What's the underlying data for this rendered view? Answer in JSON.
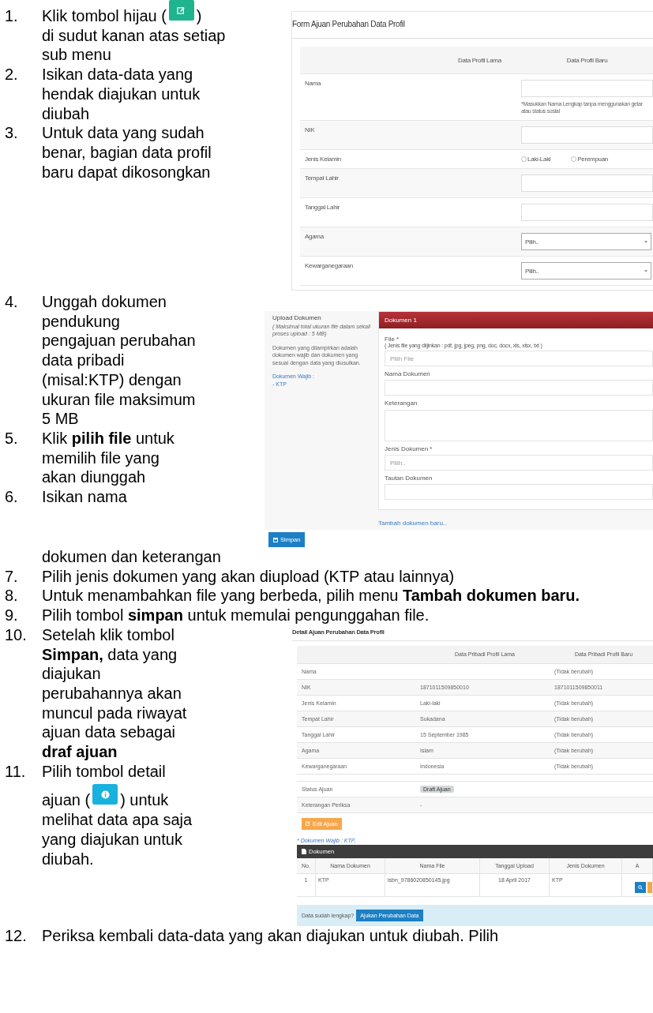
{
  "blocks": [
    {
      "kind": "with_screenshot",
      "steps": [
        {
          "kind": "edit_button",
          "number": "1.",
          "line_before": "Klik tombol hijau (",
          "line_after": ")",
          "text_after": "di sudut kanan atas setiap sub menu"
        },
        {
          "kind": "text",
          "number": "2.",
          "text": "Isikan data-data yang hendak diajukan untuk diubah"
        },
        {
          "kind": "text",
          "number": "3.",
          "text": "Untuk data yang sudah benar, bagian data profil baru dapat dikosongkan"
        }
      ],
      "screenshot": {
        "kind": "profile_form",
        "title": "Form Ajuan Perubahan Data Profil",
        "columns": [
          "Data Profil Lama",
          "Data Profil Baru"
        ],
        "rows": [
          {
            "label": "Nama",
            "kind": "text",
            "hint": "*Masukkan Nama Lengkap tanpa menggunakan gelar atau status sosial"
          },
          {
            "label": "NIK",
            "kind": "text"
          },
          {
            "label": "Jenis Kelamin",
            "kind": "radio",
            "options": [
              {
                "label": "Laki-Laki",
                "selected": false
              },
              {
                "label": "Perempuan",
                "selected": false
              }
            ]
          },
          {
            "label": "Tempat Lahir",
            "kind": "text"
          },
          {
            "label": "Tanggal Lahir",
            "kind": "text"
          },
          {
            "label": "Agama",
            "kind": "select",
            "placeholder": "Pilih.."
          },
          {
            "label": "Kewarganegaraan",
            "kind": "select",
            "placeholder": "Pilih.."
          }
        ]
      }
    },
    {
      "kind": "with_screenshot",
      "steps": [
        {
          "kind": "text",
          "number": "4.",
          "text": "Unggah dokumen pendukung pengajuan perubahan data pribadi (misal:KTP) dengan ukuran file maksimum 5 MB"
        },
        {
          "kind": "text",
          "number": "5.",
          "text": "Klik **pilih file** untuk memilih file yang akan diunggah"
        },
        {
          "kind": "text",
          "number": "6.",
          "text": "Isikan nama"
        }
      ],
      "screenshot": {
        "kind": "upload_form",
        "side_title": "Upload Dokumen",
        "side_note": "( Maksimal total ukuran file dalam sekali proses upload : 5 MB)",
        "side_text": "Dokumen yang dilampirkan adalah dokumen wajib dan dokumen yang sesuai dengan data yang diusulkan.",
        "required_label": "Dokumen Wajib :",
        "required_items": [
          "- KTP"
        ],
        "panel_title": "Dokumen 1",
        "fields": [
          {
            "label": "File *",
            "kind": "file",
            "hint": "( Jenis file yang diijinkan : pdf, jpg, jpeg, png, doc, docx, xls, xlsx, txt )",
            "placeholder": "Pilih File"
          },
          {
            "label": "Nama Dokumen",
            "kind": "text"
          },
          {
            "label": "Keterangan",
            "kind": "textarea"
          },
          {
            "label": "Jenis Dokumen *",
            "kind": "select",
            "placeholder": "Pilih.."
          },
          {
            "label": "Tautan Dokumen",
            "kind": "text"
          }
        ],
        "add_link": "Tambah dokumen baru..",
        "save_button": "Simpan"
      }
    },
    {
      "kind": "plain",
      "steps": [
        {
          "kind": "continuation",
          "text": "dokumen dan keterangan"
        },
        {
          "kind": "text",
          "number": "7.",
          "text": "Pilih jenis dokumen yang akan diupload (KTP atau lainnya)"
        },
        {
          "kind": "text",
          "number": "8.",
          "text": "Untuk menambahkan file yang berbeda, pilih menu **Tambah dokumen baru.**"
        },
        {
          "kind": "text",
          "number": "9.",
          "text": "Pilih tombol **simpan** untuk memulai pengunggahan file."
        }
      ]
    },
    {
      "kind": "with_screenshot",
      "steps": [
        {
          "kind": "text",
          "number": "10.",
          "text": "Setelah klik tombol **Simpan,** data yang diajukan perubahannya akan muncul pada riwayat ajuan data sebagai **draf ajuan**"
        },
        {
          "kind": "info_button",
          "number": "11.",
          "text": "Pilih tombol detail",
          "line_before": "ajuan (",
          "line_after": ") untuk",
          "text_after": "melihat data apa saja yang diajukan untuk diubah."
        }
      ],
      "screenshot": {
        "kind": "detail",
        "title": "Detail Ajuan Perubahan Data Profil",
        "columns": [
          "Data Pribadi Profil Lama",
          "Data Pribadi Profil Baru"
        ],
        "rows": [
          {
            "label": "Nama",
            "old": "",
            "new": "(Tidak berubah)"
          },
          {
            "label": "NIK",
            "old": "1871011509850010",
            "new": "1871011509850011"
          },
          {
            "label": "Jenis Kelamin",
            "old": "Laki-laki",
            "new": "(Tidak berubah)"
          },
          {
            "label": "Tempat Lahir",
            "old": "Sukadana",
            "new": "(Tidak berubah)"
          },
          {
            "label": "Tanggal Lahir",
            "old": "15 September 1985",
            "new": "(Tidak berubah)"
          },
          {
            "label": "Agama",
            "old": "Islam",
            "new": "(Tidak berubah)"
          },
          {
            "label": "Kewarganegaraan",
            "old": "Indonesia",
            "new": "(Tidak berubah)"
          }
        ],
        "status_label": "Status Ajuan",
        "status_badge": "Draft Ajuan",
        "remark_label": "Keterangan Periksa",
        "remark_value": "-",
        "edit_button": "Edit Ajuan",
        "required_note": "* Dokumen Wajib : KTP,",
        "doc_header": "Dokumen",
        "doc_columns": [
          "No.",
          "Nama Dokumen",
          "Nama File",
          "Tanggal Upload",
          "Jenis Dokumen",
          "A"
        ],
        "doc_rows": [
          {
            "no": "1",
            "name": "KTP",
            "file": "isbn_9786020850145.jpg",
            "date": "18 April 2017",
            "type": "KTP"
          }
        ],
        "footer_text": "Data sudah lengkap?",
        "footer_button": "Ajukan Perubahan Data"
      }
    },
    {
      "kind": "plain",
      "steps": [
        {
          "kind": "text",
          "number": "12.",
          "text": "Periksa kembali data-data yang akan diajukan untuk diubah. Pilih"
        }
      ]
    }
  ]
}
